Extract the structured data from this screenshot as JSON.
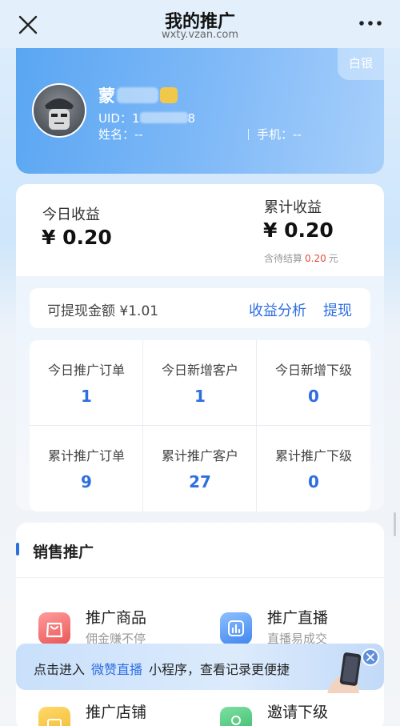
{
  "header": {
    "title": "我的推广",
    "url": "wxty.vzan.com"
  },
  "profile": {
    "level_badge": "白银",
    "name": "蒙",
    "uid": "UID：1",
    "uid_suffix": "8",
    "name_field": "姓名：--",
    "phone_field": "手机：--"
  },
  "earnings": {
    "today_label": "今日收益",
    "today_value": "¥ 0.20",
    "total_label": "累计收益",
    "total_value": "¥ 0.20",
    "pending_prefix": "含待结算",
    "pending_value": "0.20",
    "pending_unit": "元",
    "withdrawable": "可提现金额 ¥1.01",
    "analysis_link": "收益分析",
    "withdraw_link": "提现",
    "stats": [
      {
        "label": "今日推广订单",
        "value": "1"
      },
      {
        "label": "今日新增客户",
        "value": "1"
      },
      {
        "label": "今日新增下级",
        "value": "0"
      },
      {
        "label": "累计推广订单",
        "value": "9"
      },
      {
        "label": "累计推广客户",
        "value": "27"
      },
      {
        "label": "累计推广下级",
        "value": "0"
      }
    ]
  },
  "sales": {
    "title": "销售推广",
    "items": [
      {
        "title": "推广商品",
        "subtitle": "佣金赚不停",
        "icon": "shopping-bag-icon",
        "color": "#f06a6a"
      },
      {
        "title": "推广直播",
        "subtitle": "直播易成交",
        "icon": "live-chart-icon",
        "color": "#4c8ff0"
      },
      {
        "title": "推广店铺",
        "subtitle": "",
        "icon": "store-icon",
        "color": "#f2c33f"
      },
      {
        "title": "邀请下级",
        "subtitle": "",
        "icon": "invite-user-icon",
        "color": "#3fbf72"
      }
    ]
  },
  "banner": {
    "prefix": "点击进入",
    "highlight": "微赞直播",
    "suffix": "小程序，查看记录更便捷"
  }
}
